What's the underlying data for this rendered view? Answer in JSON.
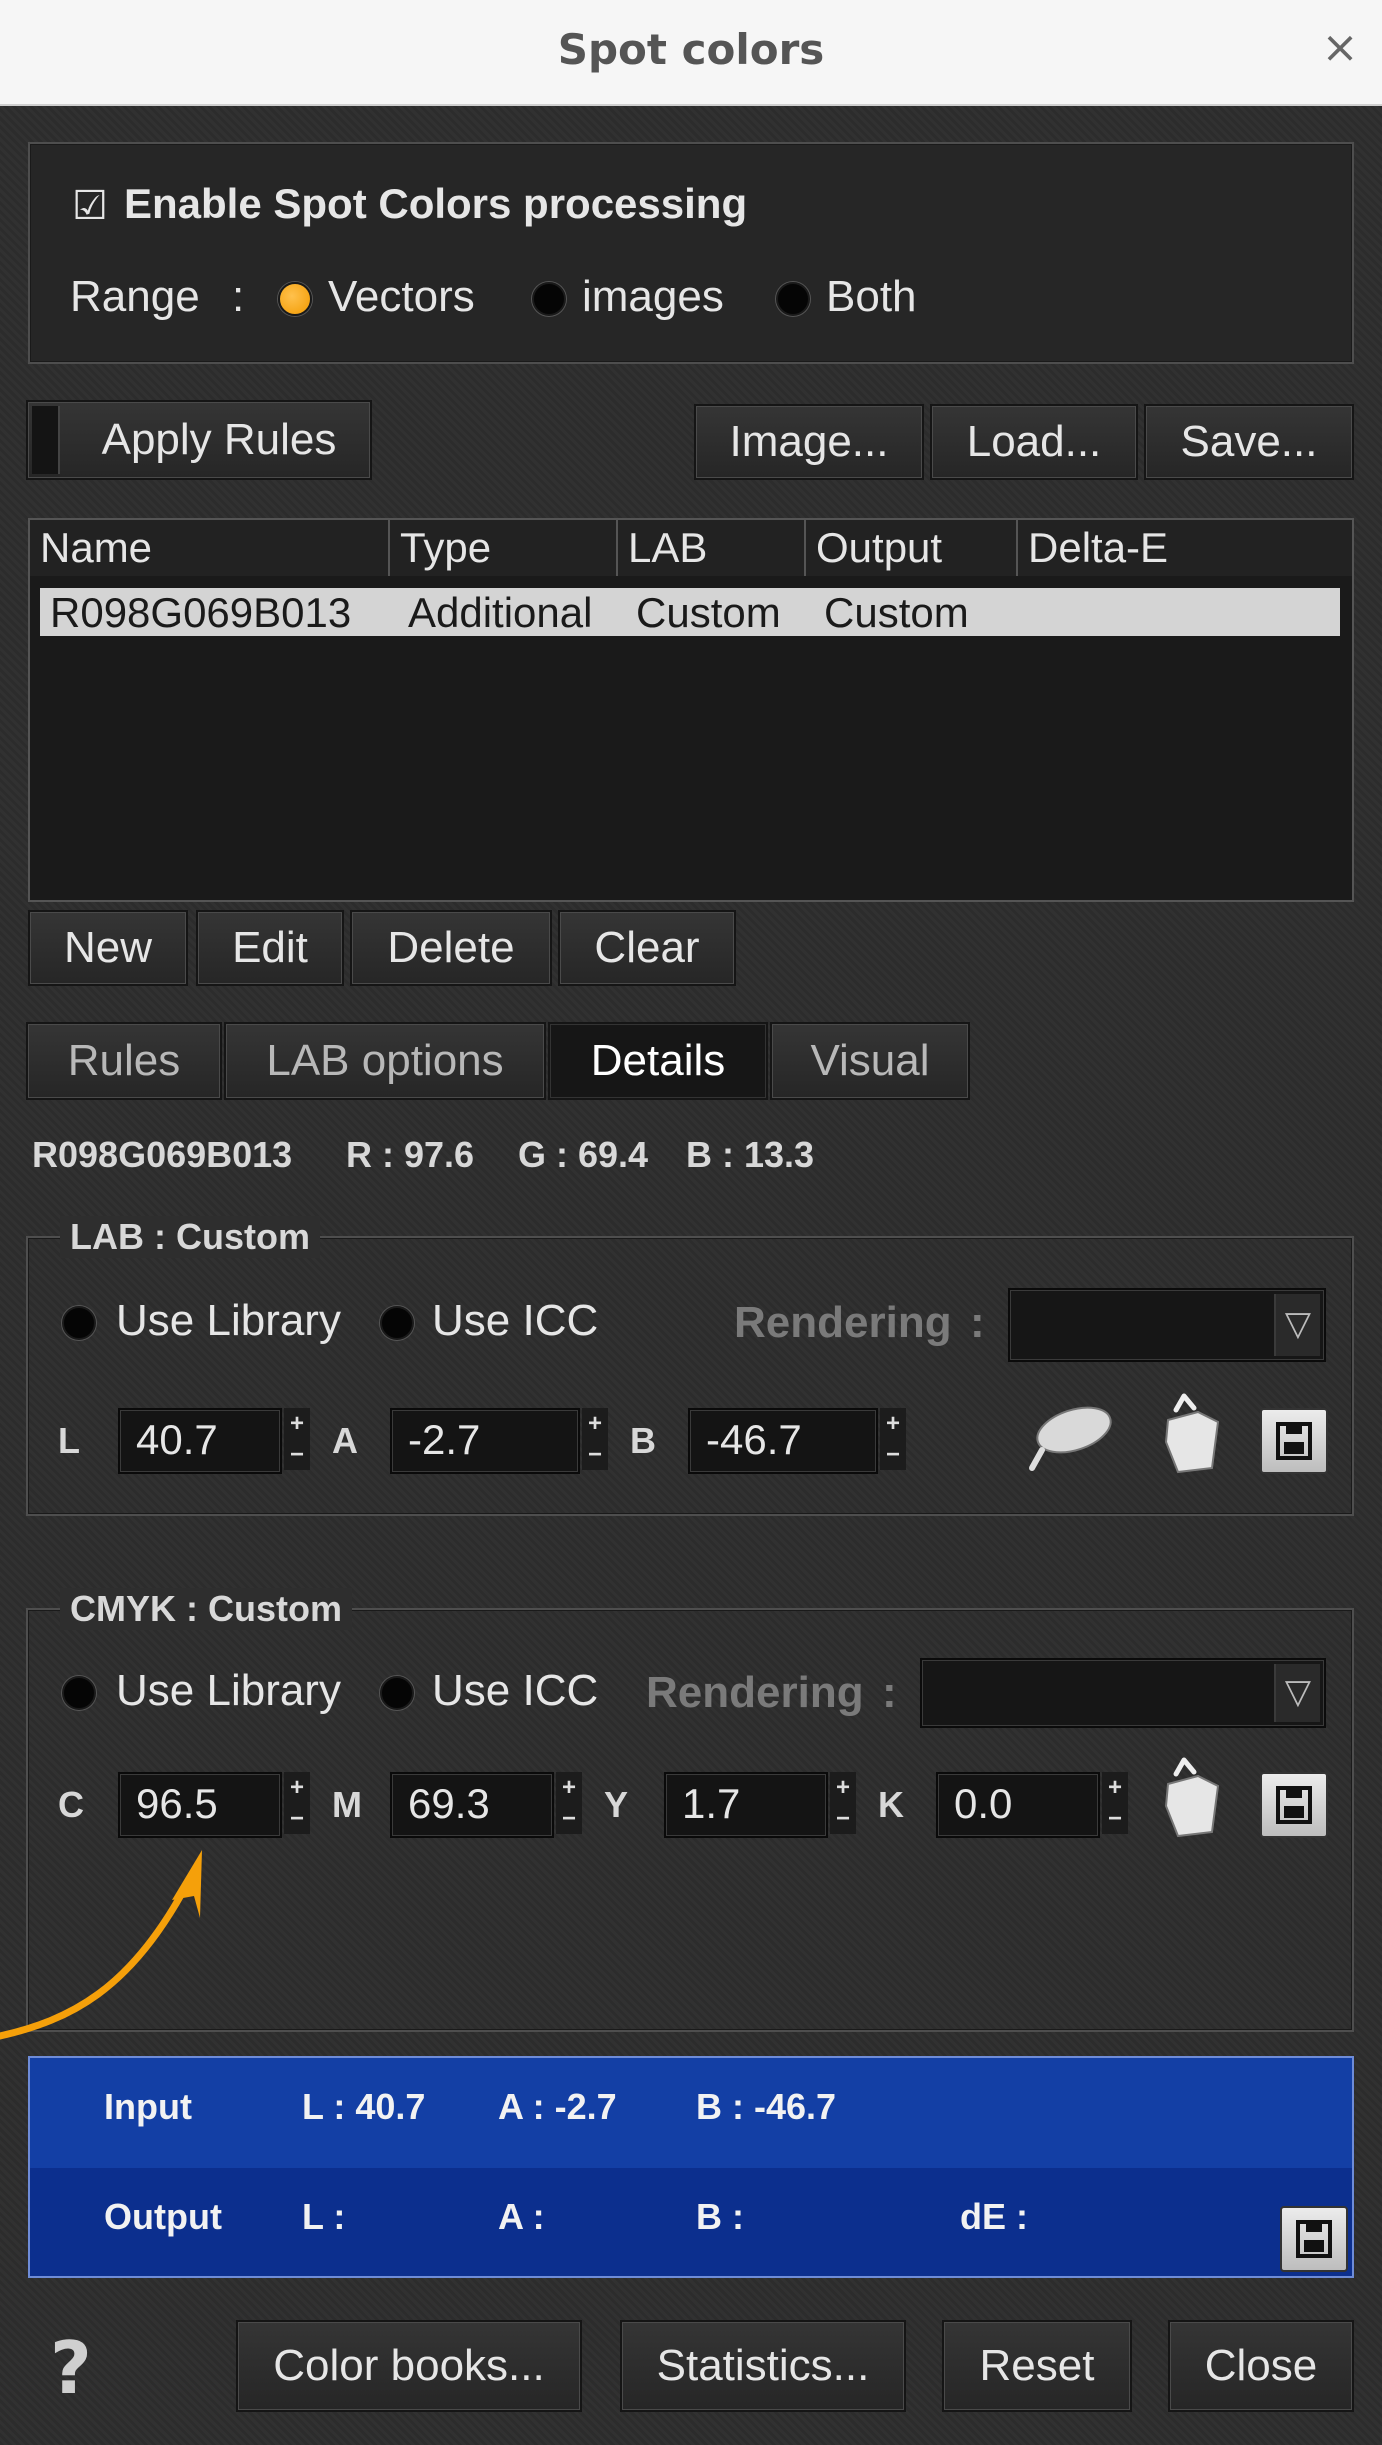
{
  "window": {
    "title": "Spot colors",
    "close_symbol": "×"
  },
  "enable": {
    "check_symbol": "☑",
    "label": "Enable Spot Colors processing"
  },
  "range": {
    "label": "Range",
    "colon": ":",
    "options": [
      "Vectors",
      "images",
      "Both"
    ],
    "selected": "Vectors"
  },
  "top_buttons": {
    "apply": "Apply Rules",
    "image": "Image...",
    "load": "Load...",
    "save": "Save..."
  },
  "table": {
    "columns": [
      "Name",
      "Type",
      "LAB",
      "Output",
      "Delta-E"
    ],
    "rows": [
      {
        "name": "R098G069B013",
        "type": "Additional",
        "lab": "Custom",
        "output": "Custom",
        "delta": ""
      }
    ]
  },
  "row_buttons": {
    "new": "New",
    "edit": "Edit",
    "delete": "Delete",
    "clear": "Clear"
  },
  "tabs": [
    "Rules",
    "LAB options",
    "Details",
    "Visual"
  ],
  "active_tab": "Details",
  "detail_header": {
    "name": "R098G069B013",
    "r": "R : 97.6",
    "g": "G : 69.4",
    "b": "B : 13.3"
  },
  "lab_section": {
    "title": "LAB : Custom",
    "use_library": "Use Library",
    "use_icc": "Use ICC",
    "rendering": "Rendering",
    "colon": ":",
    "l_label": "L",
    "l_value": "40.7",
    "a_label": "A",
    "a_value": "-2.7",
    "b_label": "B",
    "b_value": "-46.7"
  },
  "cmyk_section": {
    "title": "CMYK : Custom",
    "use_library": "Use Library",
    "use_icc": "Use ICC",
    "rendering": "Rendering",
    "colon": ":",
    "c_label": "C",
    "c_value": "96.5",
    "m_label": "M",
    "m_value": "69.3",
    "y_label": "Y",
    "y_value": "1.7",
    "k_label": "K",
    "k_value": "0.0"
  },
  "spin_symbols": {
    "up": "+",
    "down": "−"
  },
  "combo_arrow": "▽",
  "io_panel": {
    "input_label": "Input",
    "input_l": "L : 40.7",
    "input_a": "A : -2.7",
    "input_b": "B : -46.7",
    "output_label": "Output",
    "output_l": "L :",
    "output_a": "A :",
    "output_b": "B :",
    "output_de": "dE :"
  },
  "bottom": {
    "help": "?",
    "color_books": "Color books...",
    "statistics": "Statistics...",
    "reset": "Reset",
    "close": "Close"
  },
  "colors": {
    "accent_orange": "#f29a00",
    "panel_blue": "#133fa5",
    "arrow": "#f5a00a"
  }
}
